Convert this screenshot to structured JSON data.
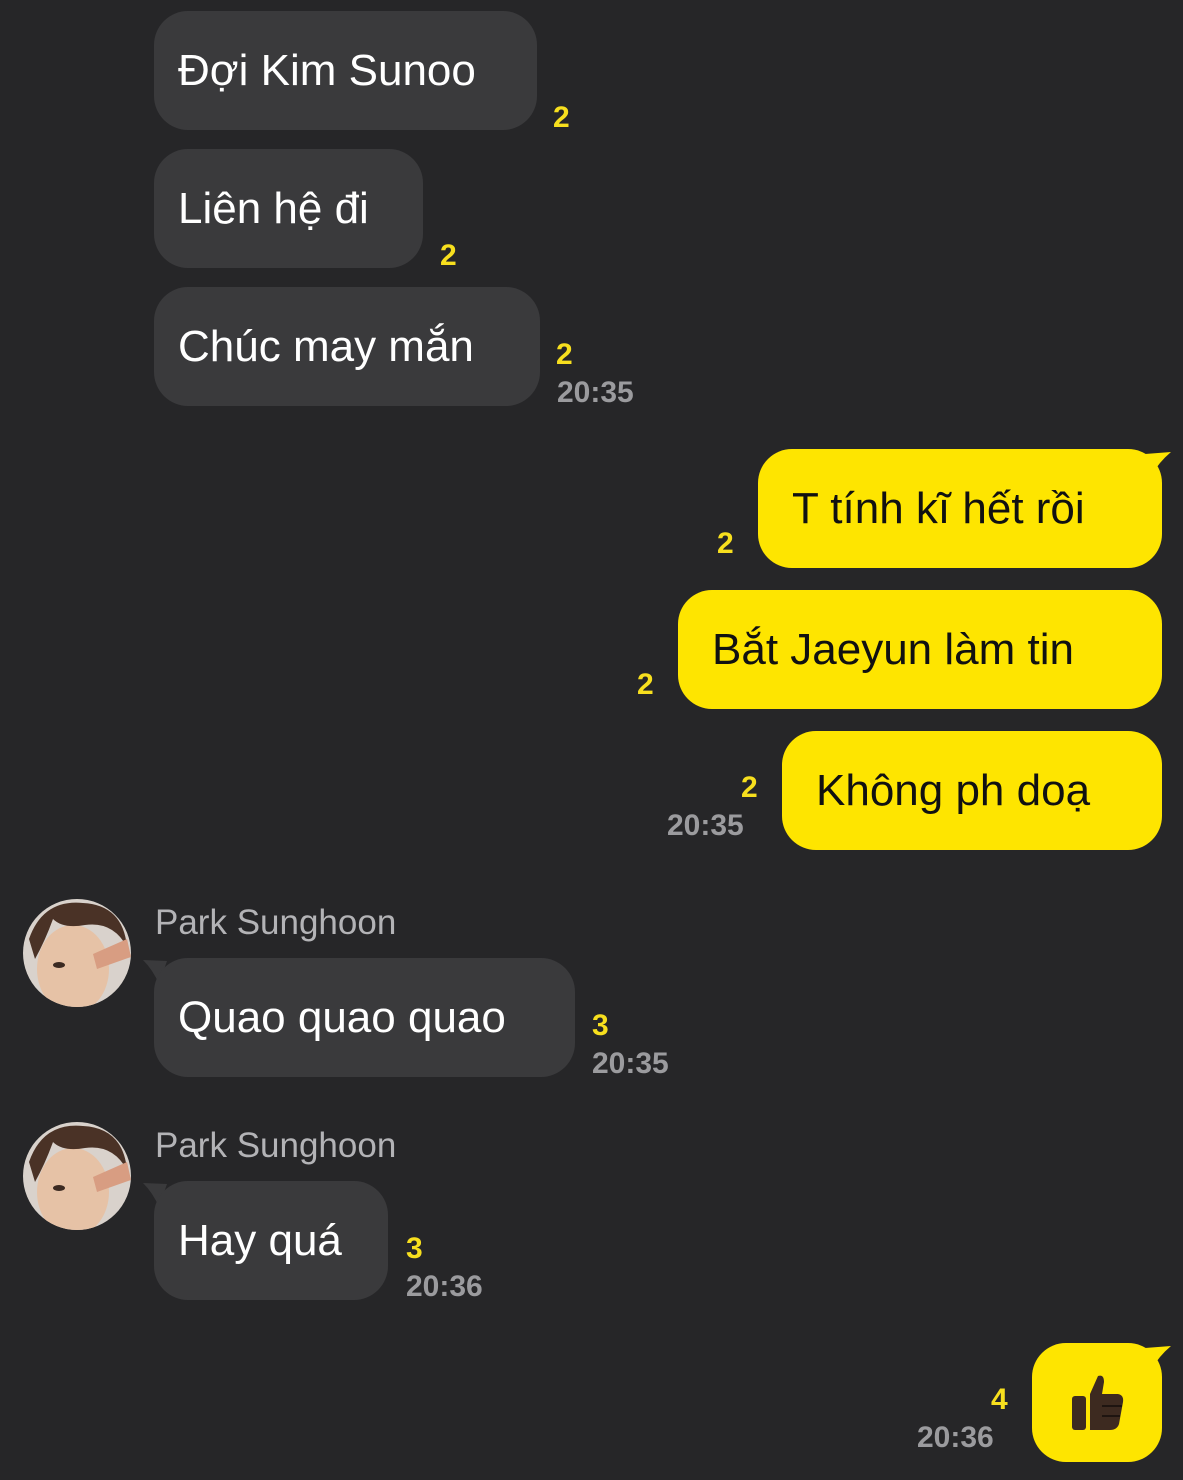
{
  "messages": {
    "m1": {
      "text": "Đợi Kim Sunoo",
      "count": "2"
    },
    "m2": {
      "text": "Liên hệ đi",
      "count": "2"
    },
    "m3": {
      "text": "Chúc may mắn",
      "count": "2",
      "time": "20:35"
    },
    "m4": {
      "text": "T tính kĩ hết rồi",
      "count": "2"
    },
    "m5": {
      "text": "Bắt Jaeyun làm tin",
      "count": "2"
    },
    "m6": {
      "text": "Không ph doạ",
      "count": "2",
      "time": "20:35"
    },
    "m7": {
      "sender": "Park Sunghoon",
      "text": "Quao quao quao",
      "count": "3",
      "time": "20:35"
    },
    "m8": {
      "sender": "Park Sunghoon",
      "text": "Hay quá",
      "count": "3",
      "time": "20:36"
    },
    "m9": {
      "emoji": "thumbs-up-icon",
      "count": "4",
      "time": "20:36"
    }
  },
  "colors": {
    "background": "#262628",
    "incoming_bubble": "#3a3a3c",
    "outgoing_bubble": "#fee500",
    "unread_count": "#f7df1e",
    "timestamp": "#9b9b9e"
  }
}
